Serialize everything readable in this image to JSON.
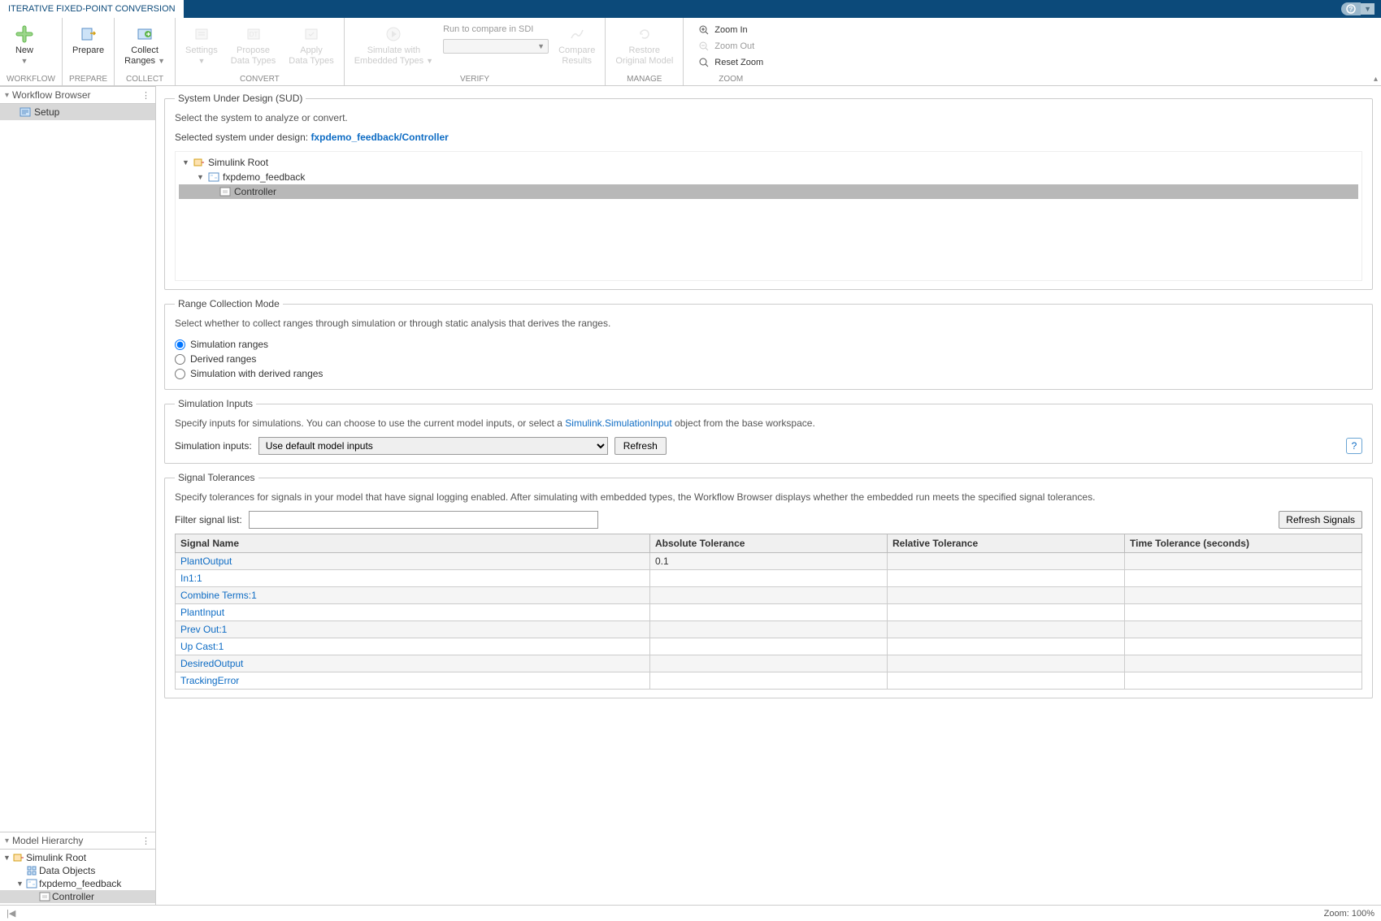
{
  "titlebar": {
    "tab": "ITERATIVE FIXED-POINT CONVERSION"
  },
  "ribbon": {
    "workflow": {
      "label": "WORKFLOW",
      "new": "New"
    },
    "prepare": {
      "label": "PREPARE",
      "prepare": "Prepare"
    },
    "collect": {
      "label": "COLLECT",
      "collect": "Collect\nRanges"
    },
    "convert": {
      "label": "CONVERT",
      "settings": "Settings",
      "propose": "Propose\nData Types",
      "apply": "Apply\nData Types"
    },
    "verify": {
      "label": "VERIFY",
      "simulate": "Simulate with\nEmbedded Types",
      "run_compare": "Run to compare in SDI",
      "compare": "Compare\nResults"
    },
    "manage": {
      "label": "MANAGE",
      "restore": "Restore\nOriginal Model"
    },
    "zoom": {
      "label": "ZOOM",
      "in": "Zoom In",
      "out": "Zoom Out",
      "reset": "Reset Zoom"
    }
  },
  "panels": {
    "workflow_browser": "Workflow Browser",
    "setup": "Setup",
    "model_hierarchy": "Model Hierarchy",
    "tree": {
      "root": "Simulink Root",
      "data_objects": "Data Objects",
      "model": "fxpdemo_feedback",
      "controller": "Controller"
    }
  },
  "sud": {
    "legend": "System Under Design (SUD)",
    "desc": "Select the system to analyze or convert.",
    "label": "Selected system under design:",
    "value": "fxpdemo_feedback/Controller",
    "tree": {
      "root": "Simulink Root",
      "model": "fxpdemo_feedback",
      "controller": "Controller"
    }
  },
  "range": {
    "legend": "Range Collection Mode",
    "desc": "Select whether to collect ranges through simulation or through static analysis that derives the ranges.",
    "opt1": "Simulation ranges",
    "opt2": "Derived ranges",
    "opt3": "Simulation with derived ranges"
  },
  "sim_inputs": {
    "legend": "Simulation Inputs",
    "desc_pre": "Specify inputs for simulations. You can choose to use the current model inputs, or select a ",
    "desc_link": "Simulink.SimulationInput",
    "desc_post": " object from the base workspace.",
    "label": "Simulation inputs:",
    "select_value": "Use default model inputs",
    "refresh": "Refresh"
  },
  "tolerances": {
    "legend": "Signal Tolerances",
    "desc": "Specify tolerances for signals in your model that have signal logging enabled. After simulating with embedded types, the Workflow Browser displays whether the embedded run meets the specified signal tolerances.",
    "filter_label": "Filter signal list:",
    "refresh_signals": "Refresh Signals",
    "cols": {
      "name": "Signal Name",
      "abs": "Absolute Tolerance",
      "rel": "Relative Tolerance",
      "time": "Time Tolerance (seconds)"
    },
    "rows": [
      {
        "name": "PlantOutput",
        "abs": "0.1",
        "rel": "",
        "time": ""
      },
      {
        "name": "In1:1",
        "abs": "",
        "rel": "",
        "time": ""
      },
      {
        "name": "Combine Terms:1",
        "abs": "",
        "rel": "",
        "time": ""
      },
      {
        "name": "PlantInput",
        "abs": "",
        "rel": "",
        "time": ""
      },
      {
        "name": "Prev Out:1",
        "abs": "",
        "rel": "",
        "time": ""
      },
      {
        "name": "Up Cast:1",
        "abs": "",
        "rel": "",
        "time": ""
      },
      {
        "name": "DesiredOutput",
        "abs": "",
        "rel": "",
        "time": ""
      },
      {
        "name": "TrackingError",
        "abs": "",
        "rel": "",
        "time": ""
      }
    ]
  },
  "statusbar": {
    "zoom": "Zoom: 100%"
  }
}
